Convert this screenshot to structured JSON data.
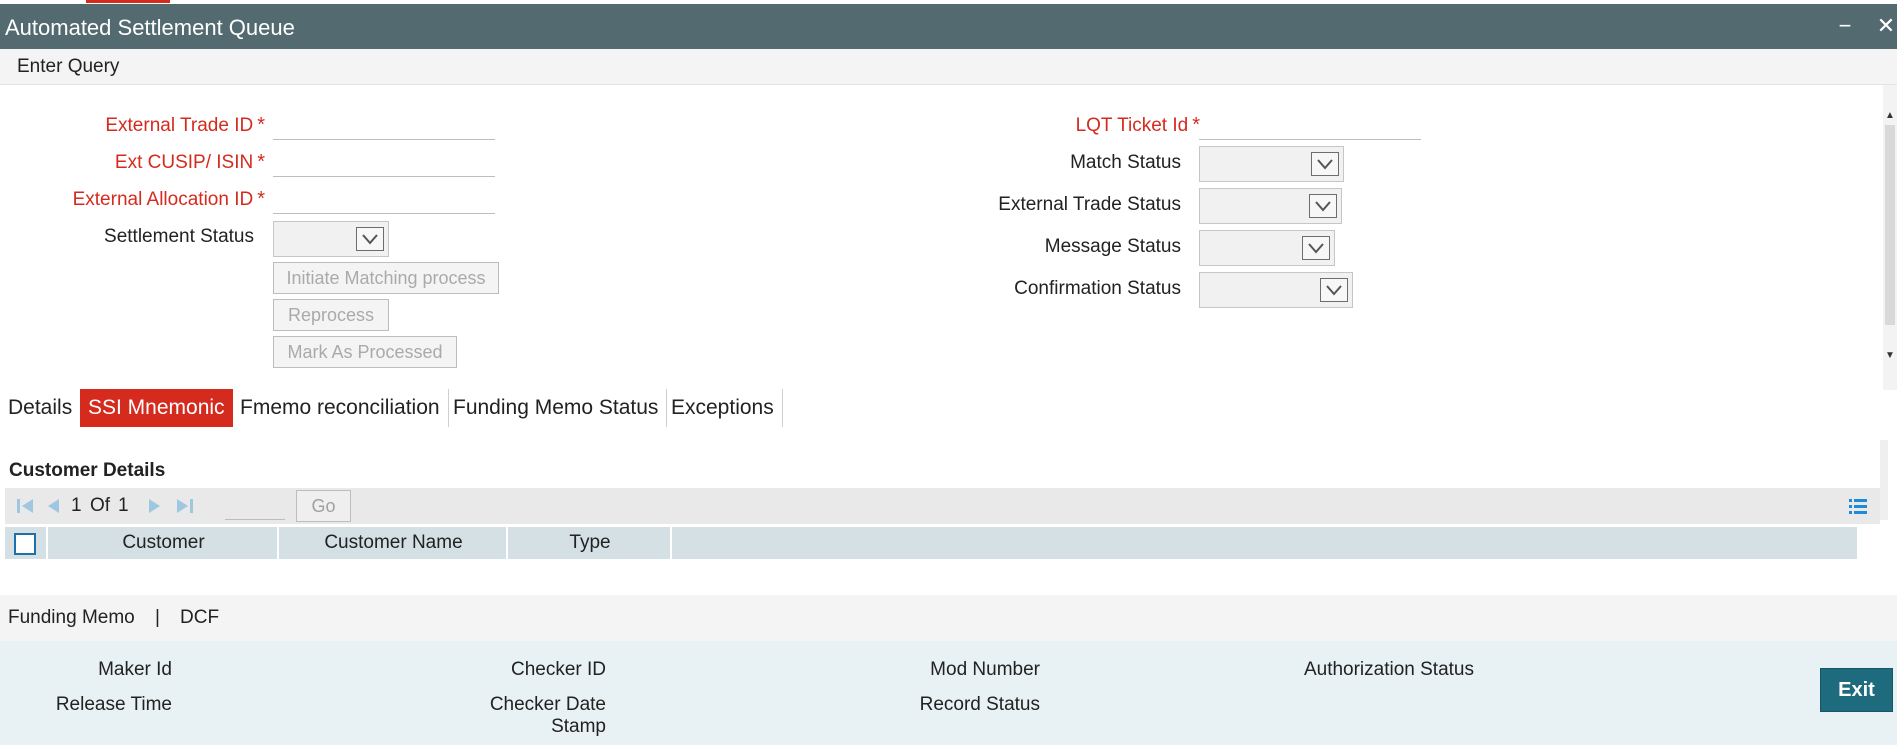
{
  "window": {
    "title": "Automated Settlement Queue",
    "minimize_glyph": "−",
    "close_glyph": "✕"
  },
  "menu": {
    "enter_query": "Enter Query"
  },
  "form": {
    "external_trade_id": "External Trade ID",
    "ext_cusip_isin": "Ext CUSIP/ ISIN",
    "external_allocation_id": "External Allocation ID",
    "settlement_status": "Settlement Status",
    "lqt_ticket_id": "LQT Ticket Id",
    "match_status": "Match Status",
    "external_trade_status": "External Trade Status",
    "message_status": "Message Status",
    "confirmation_status": "Confirmation Status",
    "required_mark": "*"
  },
  "buttons": {
    "initiate_matching": "Initiate Matching process",
    "reprocess": "Reprocess",
    "mark_processed": "Mark As Processed",
    "go": "Go",
    "exit": "Exit"
  },
  "tabs": [
    {
      "label": "Details",
      "active": false
    },
    {
      "label": "SSI Mnemonic",
      "active": true
    },
    {
      "label": "Fmemo reconciliation",
      "active": false
    },
    {
      "label": "Funding Memo Status",
      "active": false
    },
    {
      "label": "Exceptions",
      "active": false
    }
  ],
  "customer_details": {
    "title": "Customer Details",
    "pager": {
      "current": "1",
      "of_label": "Of",
      "total": "1"
    },
    "columns": [
      "Customer",
      "Customer Name",
      "Type"
    ]
  },
  "links": {
    "funding_memo": "Funding Memo",
    "separator": "|",
    "dcf": "DCF"
  },
  "audit": {
    "maker_id": "Maker Id",
    "release_time": "Release Time",
    "checker_id": "Checker ID",
    "checker_date_stamp_1": "Checker Date",
    "checker_date_stamp_2": "Stamp",
    "mod_number": "Mod Number",
    "record_status": "Record Status",
    "authorization_status": "Authorization Status"
  },
  "colors": {
    "titlebar": "#536a70",
    "accent_red": "#d52b1e",
    "exit_button": "#1f6b7e",
    "grid_header": "#d4e0e3"
  },
  "icons": [
    "minimize-icon",
    "close-icon",
    "dropdown-arrow-icon",
    "first-page-icon",
    "prev-page-icon",
    "next-page-icon",
    "last-page-icon",
    "column-settings-icon"
  ]
}
